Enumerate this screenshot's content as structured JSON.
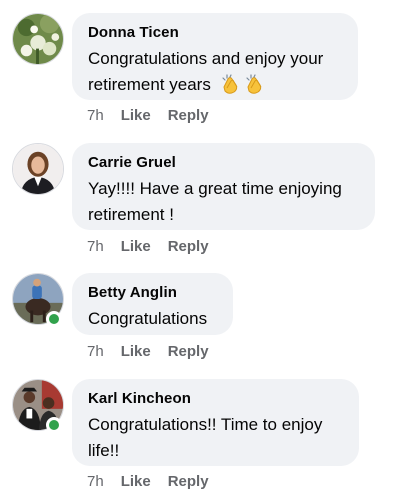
{
  "comments": [
    {
      "author": "Donna Ticen",
      "text_line1": "Congratulations and enjoy your",
      "text_line2": "retirement years",
      "emoji": [
        "clapping-hands",
        "clapping-hands"
      ],
      "time": "7h",
      "like": "Like",
      "reply": "Reply",
      "online": false
    },
    {
      "author": "Carrie Gruel",
      "text_line1": "Yay!!!! Have a great time enjoying",
      "text_line2": "retirement !",
      "time": "7h",
      "like": "Like",
      "reply": "Reply",
      "online": false
    },
    {
      "author": "Betty Anglin",
      "text_line1": "Congratulations",
      "time": "7h",
      "like": "Like",
      "reply": "Reply",
      "online": true
    },
    {
      "author": "Karl Kincheon",
      "text_line1": "Congratulations!! Time to enjoy",
      "text_line2": "life!!",
      "time": "7h",
      "like": "Like",
      "reply": "Reply",
      "online": true
    }
  ],
  "colors": {
    "bubble": "#f0f2f5",
    "meta_text": "#65676b",
    "online": "#31a24c"
  }
}
